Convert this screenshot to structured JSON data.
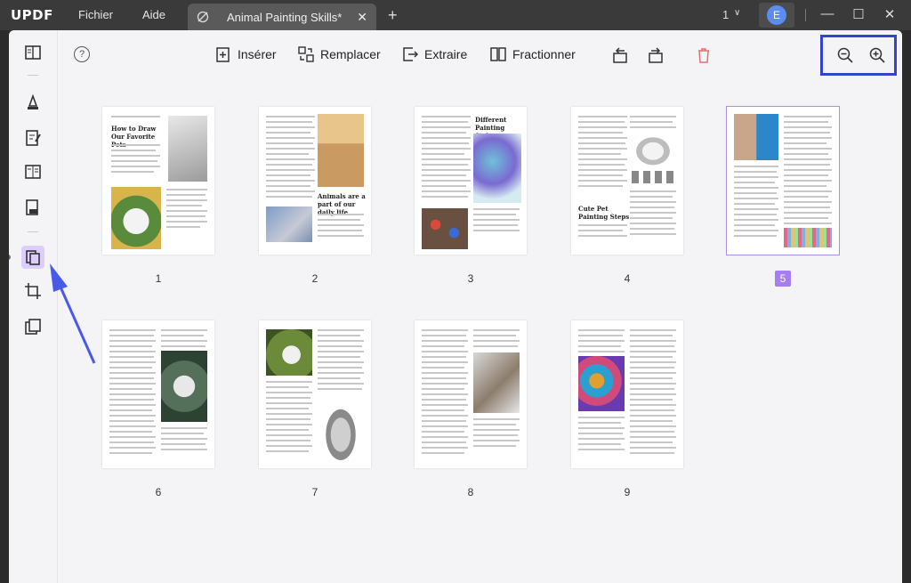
{
  "app": {
    "logo": "UPDF",
    "menus": [
      "Fichier",
      "Aide"
    ]
  },
  "tab": {
    "title": "Animal Painting Skills*",
    "count": "1"
  },
  "user": {
    "initial": "E"
  },
  "toolbar": {
    "insert": "Insérer",
    "replace": "Remplacer",
    "extract": "Extraire",
    "split": "Fractionner"
  },
  "pages": [
    {
      "number": "1",
      "title": "How to Draw Our Favorite Pets"
    },
    {
      "number": "2",
      "title": "Animals are a part of our daily life"
    },
    {
      "number": "3",
      "title": "Different Painting Styles"
    },
    {
      "number": "4",
      "title": "Cute Pet Painting Steps"
    },
    {
      "number": "5",
      "title": ""
    },
    {
      "number": "6",
      "title": ""
    },
    {
      "number": "7",
      "title": ""
    },
    {
      "number": "8",
      "title": ""
    },
    {
      "number": "9",
      "title": ""
    }
  ],
  "selected_page": "5",
  "colors": {
    "accent": "#a57ef2",
    "highlight_box": "#3344cc",
    "arrow": "#4a5ae8"
  }
}
